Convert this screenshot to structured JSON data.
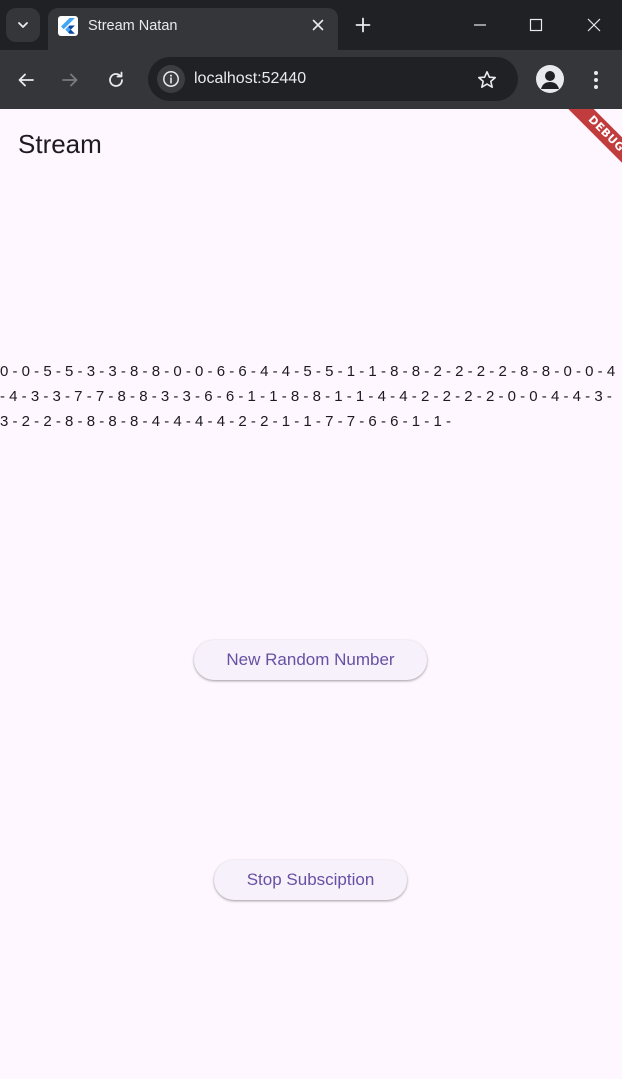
{
  "browser": {
    "tab": {
      "title": "Stream Natan",
      "favicon": "flutter-logo-icon"
    },
    "address_bar": {
      "url": "localhost:52440"
    },
    "icons": {
      "tab_search": "chevron-down-icon",
      "tab_close": "close-icon",
      "new_tab": "plus-icon",
      "minimize": "minimize-icon",
      "maximize": "maximize-icon",
      "close_window": "close-icon",
      "back": "arrow-left-icon",
      "forward": "arrow-right-icon",
      "reload": "reload-icon",
      "site_info": "info-icon",
      "bookmark": "star-icon",
      "profile": "person-icon",
      "menu": "kebab-menu-icon"
    }
  },
  "app": {
    "title": "Stream",
    "numbers": "0 - 0 - 5 - 5 - 3 - 3 - 8 - 8 - 0 - 0 - 6 - 6 - 4 - 4 - 5 - 5 - 1 - 1 - 8 - 8 - 2 - 2 - 2 - 2 - 8 - 8 - 0 - 0 - 4 - 4 - 3 - 3 - 7 - 7 - 8 - 8 - 3 - 3 - 6 - 6 - 1 - 1 - 8 - 8 - 1 - 1 - 4 - 4 - 2 - 2 - 2 - 2 - 0 - 0 - 4 - 4 - 3 - 3 - 2 - 2 - 8 - 8 - 8 - 8 - 4 - 4 - 4 - 4 - 2 - 2 - 1 - 1 - 7 - 7 - 6 - 6 - 1 - 1 - ",
    "buttons": {
      "new_random": "New Random Number",
      "stop": "Stop Subsciption"
    },
    "debug_banner": "DEBUG"
  },
  "colors": {
    "background": "#fef7ff",
    "button_text": "#6750a4",
    "button_bg": "#f7f1fb",
    "debug_banner": "#b71c1c"
  }
}
